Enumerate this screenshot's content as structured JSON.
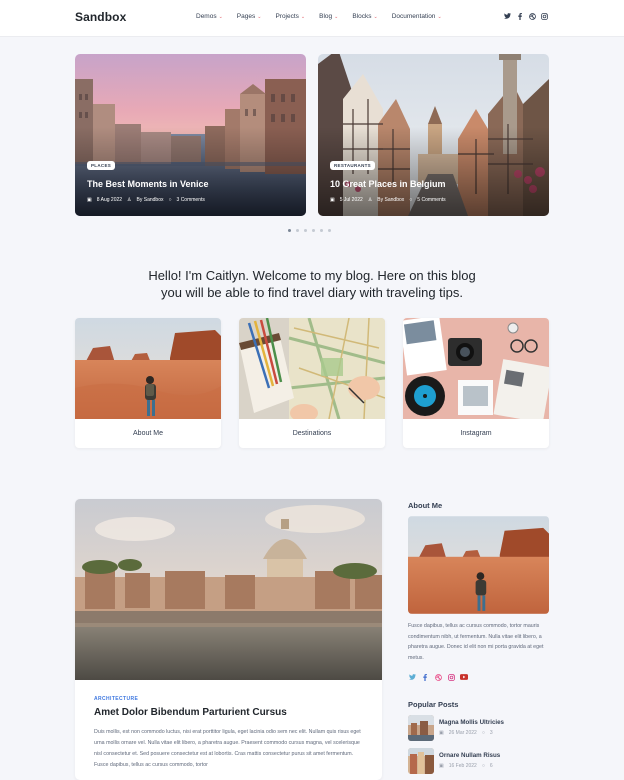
{
  "nav": {
    "logo": "Sandbox",
    "items": [
      {
        "label": "Demos"
      },
      {
        "label": "Pages"
      },
      {
        "label": "Projects"
      },
      {
        "label": "Blog"
      },
      {
        "label": "Blocks"
      },
      {
        "label": "Documentation"
      }
    ],
    "social": [
      "twitter-icon",
      "facebook-icon",
      "dribbble-icon",
      "instagram-icon"
    ]
  },
  "hero": {
    "slides": [
      {
        "tag": "PLACES",
        "title": "The Best Moments in Venice",
        "date": "8 Aug 2022",
        "author": "By Sandbox",
        "comments": "3 Comments"
      },
      {
        "tag": "RESTAURANTS",
        "title": "10 Great Places in Belgium",
        "date": "5 Jul 2022",
        "author": "By Sandbox",
        "comments": "5 Comments"
      }
    ],
    "dots_count": 6,
    "active_dot": 1
  },
  "intro": {
    "line1": "Hello! I'm Caitlyn. Welcome to my blog. Here on this blog",
    "line2": "you will be able to find travel diary with traveling tips."
  },
  "features": [
    {
      "label": "About Me"
    },
    {
      "label": "Destinations"
    },
    {
      "label": "Instagram"
    }
  ],
  "post": {
    "category": "ARCHITECTURE",
    "title": "Amet Dolor Bibendum Parturient Cursus",
    "body": "Duis mollis, est non commodo luctus, nisi erat porttitor ligula, eget lacinia odio sem nec elit. Nullam quis risus eget urna mollis ornare vel. Nulla vitae elit libero, a pharetra augue. Praesent commodo cursus magna, vel scelerisque nisl consectetur et. Sed posuere consectetur est at lobortis. Cras mattis consectetur purus sit amet fermentum. Fusce dapibus, tellus ac cursus commodo, tortor"
  },
  "sidebar": {
    "about_heading": "About Me",
    "about_text": "Fusce dapibus, tellus ac cursus commodo, tortor mauris condimentum nibh, ut fermentum. Nulla vitae elit libero, a pharetra augue. Donec id elit non mi porta gravida at eget metus.",
    "social": [
      "twitter-icon",
      "facebook-icon",
      "dribbble-icon",
      "instagram-icon",
      "youtube-icon"
    ],
    "popular_heading": "Popular Posts",
    "popular": [
      {
        "title": "Magna Mollis Ultricies",
        "date": "26 Mar 2022",
        "comments": "3"
      },
      {
        "title": "Ornare Nullam Risus",
        "date": "16 Feb 2022",
        "comments": "6"
      }
    ]
  },
  "colors": {
    "accent": "#e2626b",
    "link": "#3f78e0",
    "background": "#f5f6fa"
  }
}
